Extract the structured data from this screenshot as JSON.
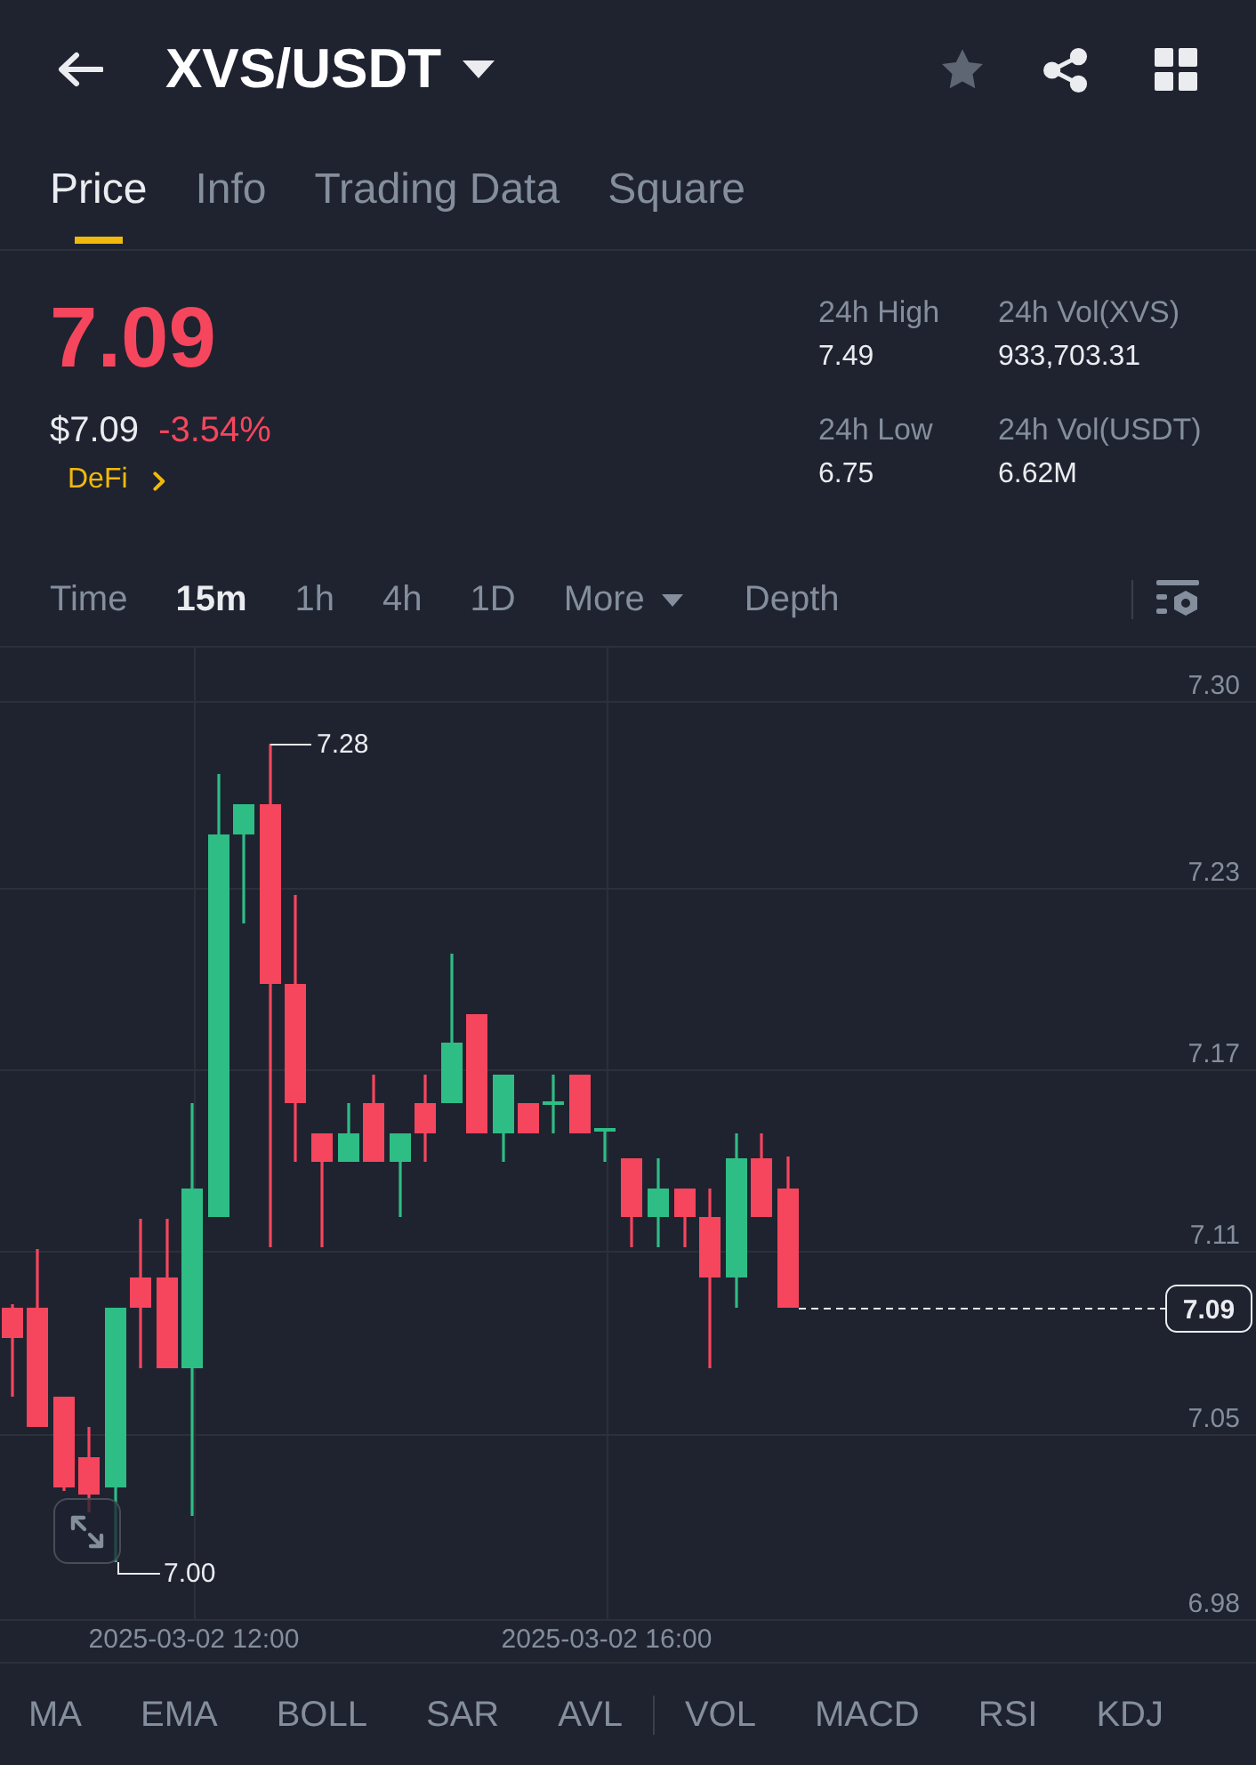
{
  "header": {
    "title": "XVS/USDT",
    "favorite": false
  },
  "tabs": [
    {
      "label": "Price",
      "selected": true
    },
    {
      "label": "Info",
      "selected": false
    },
    {
      "label": "Trading Data",
      "selected": false
    },
    {
      "label": "Square",
      "selected": false
    }
  ],
  "ticker": {
    "price": "7.09",
    "falling": true,
    "usd_price": "$7.09",
    "change": "-3.54%",
    "sector": "DeFi"
  },
  "stats": [
    {
      "label": "24h High",
      "value": "7.49"
    },
    {
      "label": "24h Vol(XVS)",
      "value": "933,703.31"
    },
    {
      "label": "24h Low",
      "value": "6.75"
    },
    {
      "label": "24h Vol(USDT)",
      "value": "6.62M"
    }
  ],
  "intervals": [
    {
      "label": "Time",
      "kind": "option",
      "selected": false
    },
    {
      "label": "15m",
      "kind": "option",
      "selected": true
    },
    {
      "label": "1h",
      "kind": "option",
      "selected": false
    },
    {
      "label": "4h",
      "kind": "option",
      "selected": false
    },
    {
      "label": "1D",
      "kind": "option",
      "selected": false
    },
    {
      "label": "More",
      "kind": "dropdown",
      "selected": false
    },
    {
      "label": "Depth",
      "kind": "option",
      "selected": false
    }
  ],
  "chart": {
    "price_axis": [
      "7.30",
      "7.23",
      "7.17",
      "7.11",
      "7.05",
      "6.98"
    ],
    "time_axis": [
      "2025-03-02 12:00",
      "2025-03-02 16:00"
    ],
    "high_marker": "7.28",
    "low_marker": "7.00",
    "last_price_tag": "7.09"
  },
  "indicators": {
    "main": [
      {
        "label": "MA",
        "selected": false
      },
      {
        "label": "EMA",
        "selected": false
      },
      {
        "label": "BOLL",
        "selected": false
      },
      {
        "label": "SAR",
        "selected": false
      },
      {
        "label": "AVL",
        "selected": false
      }
    ],
    "sub": [
      {
        "label": "VOL",
        "selected": false
      },
      {
        "label": "MACD",
        "selected": false
      },
      {
        "label": "RSI",
        "selected": false
      },
      {
        "label": "KDJ",
        "selected": false
      }
    ]
  }
}
